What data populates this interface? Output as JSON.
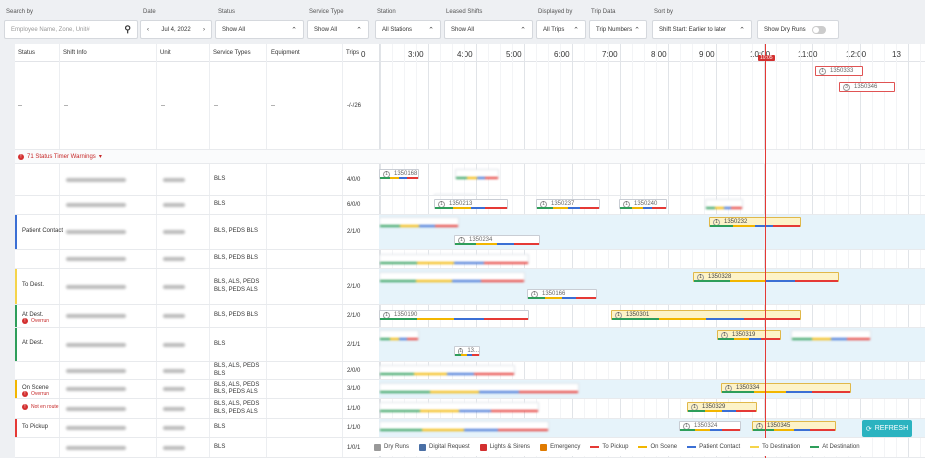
{
  "filters": {
    "search_label": "Search by",
    "search_placeholder": "Employee Name, Zone, Unit#",
    "date_label": "Date",
    "date_value": "Jul 4, 2022",
    "status_label": "Status",
    "status_value": "Show All",
    "service_label": "Service Type",
    "service_value": "Show All",
    "station_label": "Station",
    "station_value": "All Stations",
    "leased_label": "Leased Shifts",
    "leased_value": "Show All",
    "displayed_label": "Displayed by",
    "displayed_value": "All Trips",
    "tripdata_label": "Trip Data",
    "tripdata_value": "Trip Numbers",
    "sort_label": "Sort by",
    "sort_value": "Shift Start: Earlier to later",
    "dry_runs_label": "Show Dry Runs"
  },
  "columns": {
    "status": "Status",
    "shift": "Shift Info",
    "unit": "Unit",
    "service": "Service Types",
    "equipment": "Equipment",
    "trips": "Trips"
  },
  "timeline_ticks": [
    "0",
    "3:00",
    "4:00",
    "5:00",
    "6:00",
    "7:00",
    "8:00",
    "9:00",
    "10:00",
    "11:00",
    "12:00",
    "13"
  ],
  "now_badge": "10:05",
  "top_row": {
    "status": "--",
    "shift": "--",
    "unit": "--",
    "service": "--",
    "equipment": "--",
    "trips": "-/-/26"
  },
  "warning": {
    "count_text": "71 Status Timer Warnings"
  },
  "rows": [
    {
      "status": "",
      "sub": "",
      "service": "BLS",
      "trips": "4/0/0"
    },
    {
      "status": "",
      "sub": "",
      "service": "BLS",
      "trips": "6/0/0"
    },
    {
      "status": "Patient Contact",
      "sub": "",
      "service": "BLS, PEDS BLS",
      "trips": "2/1/0"
    },
    {
      "status": "",
      "sub": "",
      "service": "BLS, PEDS BLS",
      "trips": ""
    },
    {
      "status": "To Dest.",
      "sub": "",
      "service": "BLS, ALS, PEDS BLS, PEDS ALS",
      "trips": "2/1/0"
    },
    {
      "status": "At Dest.",
      "sub": "Overrun",
      "service": "BLS, PEDS BLS",
      "trips": "2/1/0"
    },
    {
      "status": "At Dest.",
      "sub": "",
      "service": "BLS",
      "trips": "2/1/1"
    },
    {
      "status": "",
      "sub": "",
      "service": "BLS, ALS, PEDS BLS",
      "trips": "2/0/0"
    },
    {
      "status": "On Scene",
      "sub": "Overrun",
      "service": "BLS, ALS, PEDS BLS, PEDS ALS",
      "trips": "3/1/0"
    },
    {
      "status": "",
      "sub": "Not en route",
      "service": "BLS, ALS, PEDS BLS, PEDS ALS",
      "trips": "1/1/0"
    },
    {
      "status": "To Pickup",
      "sub": "",
      "service": "BLS",
      "trips": "1/1/0"
    },
    {
      "status": "",
      "sub": "",
      "service": "BLS",
      "trips": "1/0/1"
    }
  ],
  "trip_labels": {
    "t1": "1350333",
    "t2": "1350346",
    "t3": "1350168",
    "t4": "1350213",
    "t5": "1350237",
    "t6": "1350240",
    "t7": "1350232",
    "t8": "1350234",
    "t9": "1350328",
    "t10": "1350166",
    "t11": "1350190",
    "t12": "1350301",
    "t13": "1350319",
    "t14": "1350334",
    "t15": "1350329",
    "t16": "1350324",
    "t17": "1350345",
    "t18": "13..."
  },
  "legend": [
    "Dry Runs",
    "Digital Request",
    "Lights & Sirens",
    "Emergency",
    "To Pickup",
    "On Scene",
    "Patient Contact",
    "To Destination",
    "At Destination"
  ],
  "legend_colors": [
    "#999999",
    "#4a6fa5",
    "#d32f2f",
    "#e07b00",
    "#e53935",
    "#f2b600",
    "#3b6fd4",
    "#f5d44a",
    "#2e9e5a"
  ],
  "refresh_label": "REFRESH"
}
